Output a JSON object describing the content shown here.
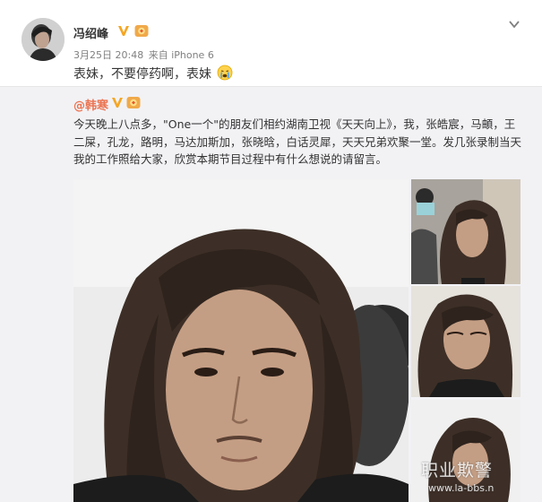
{
  "post": {
    "username": "冯绍峰",
    "timestamp": "3月25日 20:48",
    "source": "来自 iPhone 6",
    "text": "表妹，不要停药啊，表妹",
    "avatar_icon": "user-avatar",
    "vip_icon": "verified-v-icon",
    "medal_icon": "member-medal-icon",
    "more_icon": "chevron-down-icon",
    "emoji_icon": "crying-emoji"
  },
  "repost": {
    "author": "@韩寒",
    "text": "今天晚上八点多，\"One一个\"的朋友们相约湖南卫视《天天向上》，我，张皓宸，马頔，王二屎，孔龙，路明，马达加斯加，张晓晗，白话灵犀，天天兄弟欢聚一堂。发几张录制当天我的工作照给大家，欣赏本期节目过程中有什么想说的请留言。",
    "images": [
      "main-selfie-photo",
      "thumb-photo-1",
      "thumb-photo-2",
      "thumb-photo-3"
    ]
  },
  "watermark": {
    "line1": "职业欺警",
    "line2": "www.la-bbs.n"
  },
  "colors": {
    "link": "#eb7350",
    "meta": "#808080",
    "repost_bg": "#f2f2f5",
    "vip": "#f5a623"
  }
}
